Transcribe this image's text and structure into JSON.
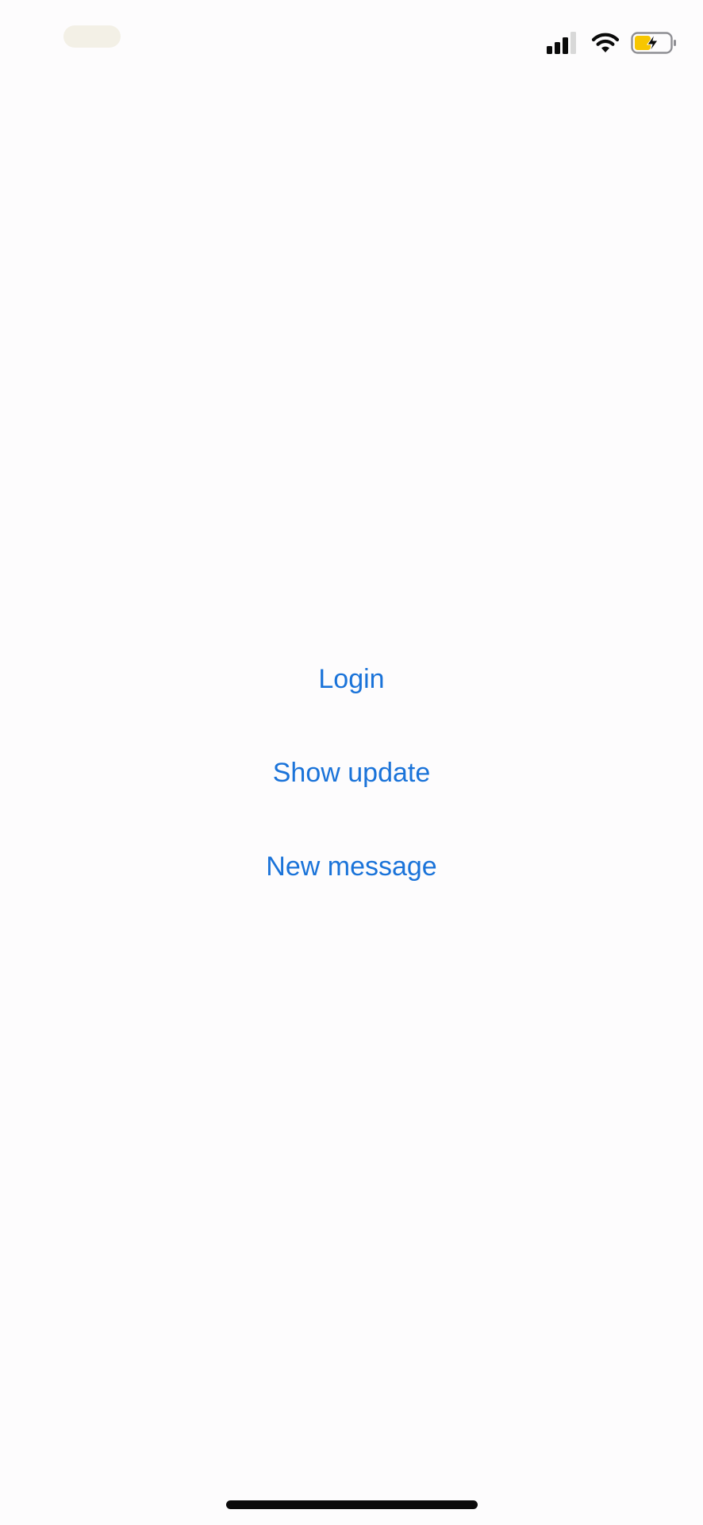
{
  "status_bar": {
    "icons": [
      "cellular-signal-icon",
      "wifi-icon",
      "battery-charging-icon"
    ],
    "battery_fill_color": "#f7c600"
  },
  "buttons": {
    "login_label": "Login",
    "show_update_label": "Show update",
    "new_message_label": "New message"
  },
  "colors": {
    "accent": "#1a73d9",
    "background": "#fdfcfd"
  }
}
